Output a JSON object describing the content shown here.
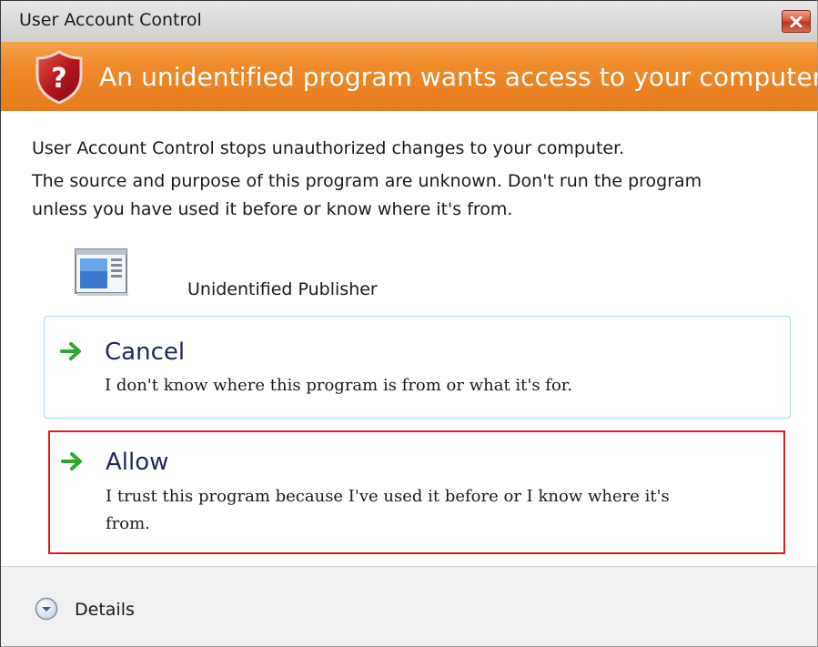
{
  "window": {
    "title": "User Account Control",
    "close_icon": "close-icon"
  },
  "banner": {
    "icon": "shield-question-icon",
    "text": "An unidentified program wants access to your computer"
  },
  "message": {
    "line1": "User Account Control stops unauthorized changes to your computer.",
    "line2": "The source and purpose of this program are unknown.  Don't run the program",
    "line3": "unless you have used it before or know where it's from."
  },
  "program": {
    "icon": "program-window-icon",
    "publisher": "Unidentified Publisher"
  },
  "options": [
    {
      "icon": "arrow-right-icon",
      "title": "Cancel",
      "description": "I don't know where this program is from or what it's for."
    },
    {
      "icon": "arrow-right-icon",
      "title": "Allow",
      "description_line1": "I trust this program because I've used it before or I know where it's",
      "description_line2": "from."
    }
  ],
  "footer": {
    "icon": "chevron-down-icon",
    "details_label": "Details"
  },
  "colors": {
    "banner": "#ef8a2a",
    "highlight_border": "#e11b1b",
    "cancel_border": "#9fdcec",
    "arrow": "#2fa82f"
  }
}
